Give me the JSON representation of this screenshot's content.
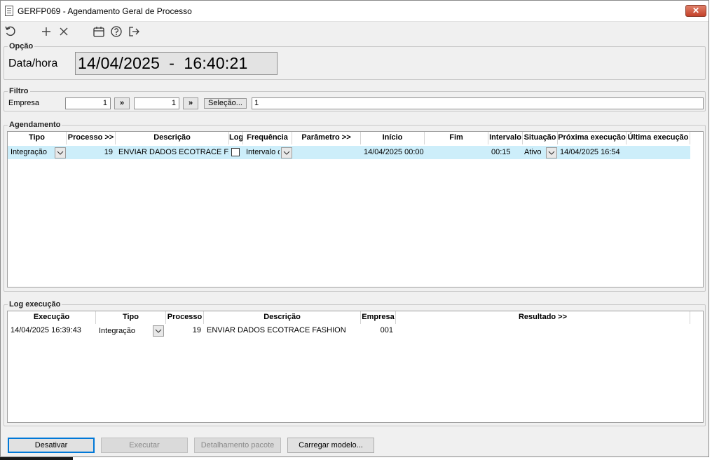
{
  "window": {
    "title": "GERFP069 - Agendamento Geral de Processo",
    "close_label": "✕"
  },
  "toolbar": {
    "icons": [
      "refresh-icon",
      "add-icon",
      "delete-icon",
      "calendar-icon",
      "help-icon",
      "exit-icon"
    ]
  },
  "opcao": {
    "legend": "Opção",
    "label": "Data/hora",
    "value": "14/04/2025  -  16:40:21"
  },
  "filtro": {
    "legend": "Filtro",
    "empresa_label": "Empresa",
    "from_value": "1",
    "to_value": "1",
    "more_label": "»",
    "selecao_label": "Seleção...",
    "selection_text": "1"
  },
  "agendamento": {
    "legend": "Agendamento",
    "columns": [
      "Tipo",
      "Processo >>",
      "Descrição",
      "Log",
      "Frequência",
      "Parâmetro >>",
      "Início",
      "Fim",
      "Intervalo",
      "Situação",
      "Próxima execução",
      "Última execução"
    ],
    "rows": [
      {
        "tipo": "Integração",
        "processo": "19",
        "descricao": "ENVIAR DADOS ECOTRACE FASHION",
        "frequencia": "Intervalo de minutos",
        "parametro": "",
        "inicio": "14/04/2025 00:00",
        "fim": "",
        "intervalo": "00:15",
        "situacao": "Ativo",
        "proxima": "14/04/2025 16:54",
        "ultima": ""
      }
    ]
  },
  "log_execucao": {
    "legend": "Log execução",
    "columns": [
      "Execução",
      "Tipo",
      "Processo",
      "Descrição",
      "Empresa",
      "Resultado >>"
    ],
    "rows": [
      {
        "execucao": "14/04/2025 16:39:43",
        "tipo": "Integração",
        "processo": "19",
        "descricao": "ENVIAR DADOS ECOTRACE FASHION",
        "empresa": "001",
        "resultado": ""
      }
    ]
  },
  "buttons": {
    "desativar": "Desativar",
    "executar": "Executar",
    "detalhamento": "Detalhamento pacote",
    "carregar": "Carregar modelo..."
  }
}
